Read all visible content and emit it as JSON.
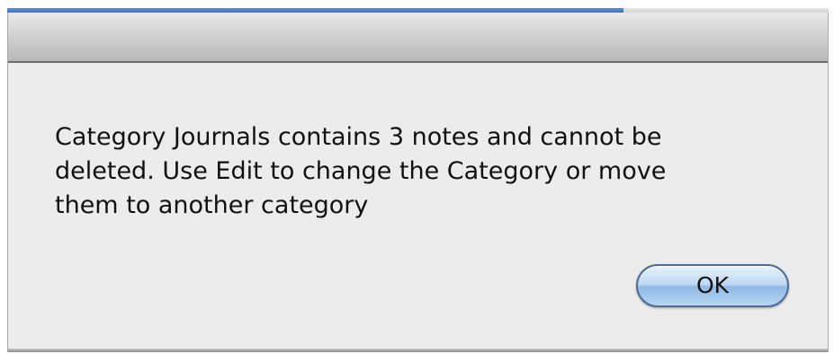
{
  "dialog": {
    "message": "Category Journals contains 3 notes and cannot be\ndeleted. Use Edit to change the Category or move\nthem to another category",
    "ok_label": "OK"
  },
  "progress": {
    "fraction": 0.75
  },
  "colors": {
    "accent_blue": "#3a6fcb",
    "dialog_background": "#ececec",
    "button_blue": "#9cc3ea"
  }
}
